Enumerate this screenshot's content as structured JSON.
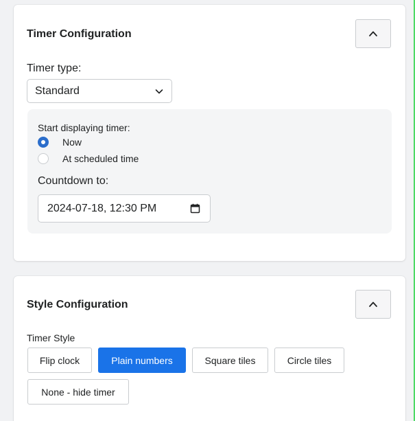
{
  "timer_config": {
    "title": "Timer Configuration",
    "collapse_icon": "chevron-up-icon",
    "timer_type_label": "Timer type:",
    "timer_type_selected": "Standard",
    "start_displaying_label": "Start displaying timer:",
    "radio_options": [
      {
        "label": "Now",
        "checked": true
      },
      {
        "label": "At scheduled time",
        "checked": false
      }
    ],
    "countdown_label": "Countdown to:",
    "countdown_value": "2024-07-18, 12:30 PM"
  },
  "style_config": {
    "title": "Style Configuration",
    "collapse_icon": "chevron-up-icon",
    "timer_style_label": "Timer Style",
    "styles": [
      {
        "label": "Flip clock",
        "active": false
      },
      {
        "label": "Plain numbers",
        "active": true
      },
      {
        "label": "Square tiles",
        "active": false
      },
      {
        "label": "Circle tiles",
        "active": false
      },
      {
        "label": "None - hide timer",
        "active": false
      }
    ]
  },
  "colors": {
    "accent": "#1a73e8",
    "radio_checked": "#2c6ecb",
    "border": "#c9cccf",
    "background": "#f1f2f4"
  }
}
